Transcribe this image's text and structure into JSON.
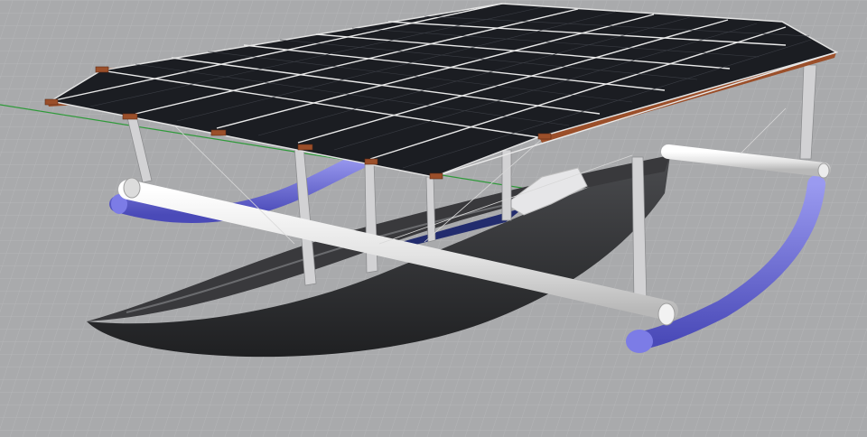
{
  "viewport": {
    "label": "",
    "colors": {
      "ground": "#a9aaac",
      "grid_line": "#bdbec0",
      "axis_green": "#2f9a3a",
      "panel": "#1b1d22",
      "panel_cell_line": "#3a3d44",
      "panel_frame": "#e2e2e2",
      "wood_rail": "#9b4f2a",
      "hull_dark": "#2c2d30",
      "hull_side": "#3f4043",
      "hull_rim": "#6a6b6e",
      "inner_blue": "#222c6e",
      "pipe_white": "#e8e8e8",
      "float_blue": "#7a7ad8",
      "post": "#d2d2d4"
    },
    "objects": {
      "ground_icon": "grid-floor",
      "axis_icon": "world-axis-icon",
      "hull_icon": "boat-hull",
      "panels_icon": "solar-panel-array"
    }
  }
}
